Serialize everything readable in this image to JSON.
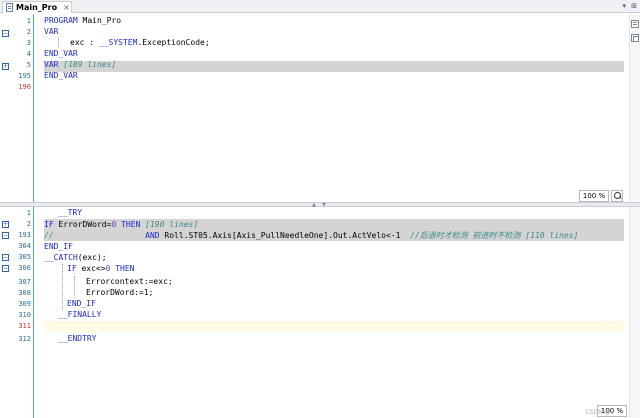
{
  "tab": {
    "label": "Main_Pro",
    "close": "×",
    "menu": "▾",
    "pin": "⊞"
  },
  "top": {
    "zoom": "100 %",
    "lines": [
      {
        "n": "1",
        "red": false,
        "fold": ""
      },
      {
        "n": "2",
        "red": false,
        "fold": "−"
      },
      {
        "n": "3",
        "red": false,
        "fold": ""
      },
      {
        "n": "4",
        "red": false,
        "fold": ""
      },
      {
        "n": "5",
        "red": false,
        "fold": "+"
      },
      {
        "n": "195",
        "red": false,
        "fold": ""
      },
      {
        "n": "196",
        "red": true,
        "fold": ""
      }
    ],
    "code": {
      "l1": {
        "kw": "PROGRAM",
        "rest": " Main_Pro"
      },
      "l2": {
        "kw": "VAR"
      },
      "l3": {
        "name": "exc : ",
        "ns": "__SYSTEM",
        "type": ".ExceptionCode;"
      },
      "l4": {
        "kw": "END_VAR"
      },
      "l5": {
        "kw": "VAR",
        "collapsed": " [189 lines]"
      },
      "l6": {
        "kw": "END_VAR"
      }
    }
  },
  "bottom": {
    "zoom": "100 %",
    "lines": [
      {
        "n": "1",
        "red": false,
        "fold": ""
      },
      {
        "n": "2",
        "red": false,
        "fold": "+"
      },
      {
        "n": "193",
        "red": false,
        "fold": "−"
      },
      {
        "n": "304",
        "red": false,
        "fold": ""
      },
      {
        "n": "305",
        "red": false,
        "fold": "−"
      },
      {
        "n": "306",
        "red": false,
        "fold": "−"
      },
      {
        "n": "307",
        "red": false,
        "fold": ""
      },
      {
        "n": "308",
        "red": false,
        "fold": ""
      },
      {
        "n": "309",
        "red": false,
        "fold": ""
      },
      {
        "n": "310",
        "red": false,
        "fold": ""
      },
      {
        "n": "311",
        "red": true,
        "fold": ""
      },
      {
        "n": "312",
        "red": false,
        "fold": ""
      }
    ],
    "code": {
      "l1": {
        "kw": "__TRY"
      },
      "l2": {
        "kw1": "IF",
        "mid": " ErrorDWord=",
        "num": "0",
        "sp": " ",
        "kw2": "THEN",
        "collapsed": " [190 lines]"
      },
      "l3": {
        "cm1": "//",
        "pad": "                   ",
        "kw": "AND",
        "mid": " Roll.ST05.Axis[Axis_PullNeedleOne].Out.ActVelo<-1  ",
        "cm2": "//后退时才检测 前进时不检测 [110 lines]"
      },
      "l4": {
        "kw": "END_IF"
      },
      "l5": {
        "kw": "__CATCH",
        "rest": "(exc);"
      },
      "l6": {
        "kw1": "IF",
        "mid": " exc<>",
        "num": "0",
        "sp": " ",
        "kw2": "THEN"
      },
      "l7": {
        "text": "Errorcontext:=exc;"
      },
      "l8": {
        "text": "ErrorDWord:=1;"
      },
      "l9": {
        "kw": "END_IF"
      },
      "l10": {
        "kw": "__FINALLY"
      },
      "l12": {
        "kw": "__ENDTRY"
      }
    }
  },
  "watermark": "CSDN @c"
}
